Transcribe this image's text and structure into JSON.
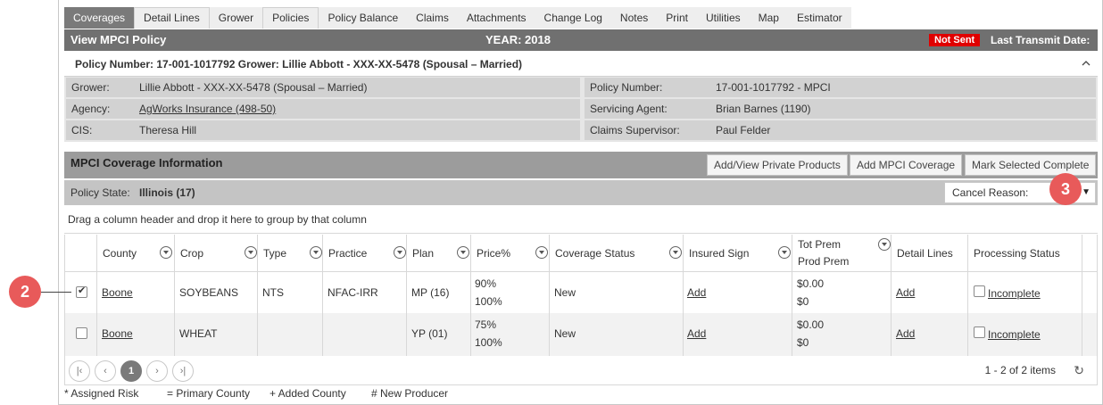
{
  "tabs": [
    {
      "label": "Coverages"
    },
    {
      "label": "Detail Lines"
    },
    {
      "label": "Grower"
    },
    {
      "label": "Policies"
    },
    {
      "label": "Policy Balance"
    },
    {
      "label": "Claims"
    },
    {
      "label": "Attachments"
    },
    {
      "label": "Change Log"
    },
    {
      "label": "Notes"
    },
    {
      "label": "Print"
    },
    {
      "label": "Utilities"
    },
    {
      "label": "Map"
    },
    {
      "label": "Estimator"
    }
  ],
  "header": {
    "title": "View MPCI Policy",
    "year": "YEAR: 2018",
    "status_badge": "Not Sent",
    "transmit_label": "Last Transmit Date:"
  },
  "policy_line": {
    "text": "Policy Number: 17-001-1017792 Grower: Lillie Abbott - XXX-XX-5478 (Spousal – Married)",
    "caret": "^"
  },
  "info": {
    "grower_label": "Grower:",
    "grower_value": "Lillie Abbott - XXX-XX-5478 (Spousal – Married)",
    "agency_label": "Agency:",
    "agency_value": "AgWorks Insurance (498-50)",
    "cis_label": "CIS:",
    "cis_value": "Theresa Hill",
    "policy_number_label": "Policy Number:",
    "policy_number_value": "17-001-1017792 - MPCI",
    "servicing_agent_label": "Servicing Agent:",
    "servicing_agent_value": "Brian Barnes (1190)",
    "claims_supervisor_label": "Claims Supervisor:",
    "claims_supervisor_value": "Paul Felder"
  },
  "coverage": {
    "title": "MPCI Coverage Information",
    "btn_private": "Add/View Private Products",
    "btn_add": "Add MPCI Coverage",
    "btn_mark": "Mark Selected Complete",
    "policy_state_label": "Policy State:",
    "policy_state_value": "Illinois (17)",
    "cancel_reason_label": "Cancel Reason:",
    "cancel_reason_arrow": "▼",
    "drag_hint": "Drag a column header and drop it here to group by that column"
  },
  "table": {
    "headers": {
      "county": "County",
      "crop": "Crop",
      "type": "Type",
      "practice": "Practice",
      "plan": "Plan",
      "price": "Price%",
      "coverage_status": "Coverage Status",
      "insured_sign": "Insured Sign",
      "tot_prem": "Tot Prem",
      "prod_prem": "Prod Prem",
      "detail_lines": "Detail Lines",
      "processing_status": "Processing Status"
    },
    "rows": [
      {
        "checked": true,
        "county": "Boone",
        "crop": "SOYBEANS",
        "type": "NTS",
        "practice": "NFAC-IRR",
        "plan": "MP (16)",
        "price1": "90%",
        "price2": "100%",
        "coverage_status": "New",
        "insured_sign": "Add",
        "tot_prem": "$0.00",
        "prod_prem": "$0",
        "detail_lines": "Add",
        "processing_status": "Incomplete"
      },
      {
        "checked": false,
        "county": "Boone",
        "crop": "WHEAT",
        "type": "",
        "practice": "",
        "plan": "YP (01)",
        "price1": "75%",
        "price2": "100%",
        "coverage_status": "New",
        "insured_sign": "Add",
        "tot_prem": "$0.00",
        "prod_prem": "$0",
        "detail_lines": "Add",
        "processing_status": "Incomplete"
      }
    ]
  },
  "pager": {
    "first": "|‹",
    "prev": "‹",
    "current_page": "1",
    "next": "›",
    "last": "›|",
    "count": "1 - 2 of 2 items",
    "refresh": "↻"
  },
  "legend": {
    "assigned": "* Assigned Risk",
    "primary": "= Primary County",
    "added": "+ Added County",
    "new_producer": "# New Producer"
  },
  "callouts": {
    "two": "2",
    "three": "3"
  },
  "colors": {
    "not_sent_badge": "#e00000",
    "header_bar": "#707070",
    "callout": "#e85a5a",
    "link": "#1a5a9a"
  }
}
